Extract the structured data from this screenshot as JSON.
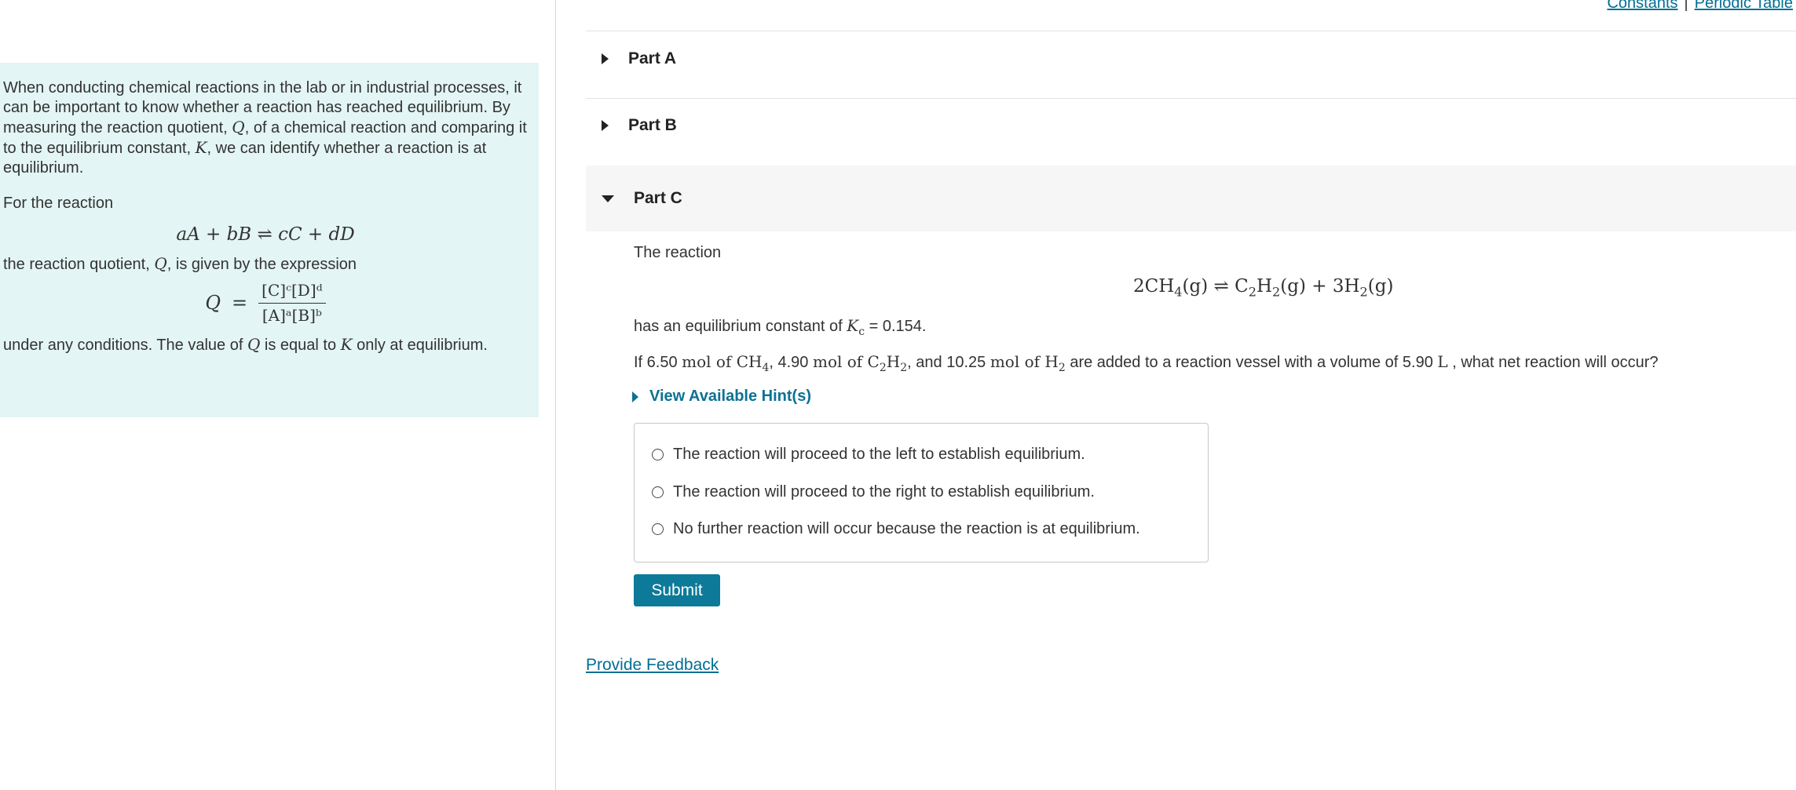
{
  "top_links": {
    "constants": "Constants",
    "separator": "|",
    "periodic_table": "Periodic Table"
  },
  "intro": {
    "para1_a": "When conducting chemical reactions in the lab or in industrial processes, it can be important to know whether a reaction has reached equilibrium. By measuring the reaction quotient, ",
    "Q": "Q",
    "para1_b": ", of a chemical reaction and comparing it to the equilibrium constant, ",
    "K": "K",
    "para1_c": ", we can identify whether a reaction is at equilibrium.",
    "for_reaction": "For the reaction",
    "general_eq": "aA + bB ⇌ cC + dD",
    "quotient_a": "the reaction quotient, ",
    "quotient_b": ", is given by the expression",
    "q_lhs": "Q",
    "equals": "=",
    "numerator": "[C]ᶜ[D]ᵈ",
    "denominator": "[A]ᵃ[B]ᵇ",
    "under_a": "under any conditions. The value of ",
    "under_b": " is equal to ",
    "under_c": " only at equilibrium."
  },
  "parts": [
    {
      "label": "Part A",
      "expanded": false
    },
    {
      "label": "Part B",
      "expanded": false
    },
    {
      "label": "Part C",
      "expanded": true
    }
  ],
  "part_c": {
    "intro": "The reaction",
    "eq_left": "2CH",
    "eq_left_sub": "4",
    "eq_left_state": "(g) ⇌ C",
    "eq_c_sub": "2",
    "eq_h": "H",
    "eq_h_sub": "2",
    "eq_mid": "(g) + 3H",
    "eq_h2_sub": "2",
    "eq_end": "(g)",
    "kc_a": "has an equilibrium constant of ",
    "kc_symbol": "K",
    "kc_sub": "c",
    "kc_b": " = 0.154.",
    "q_if": "If 6.50 ",
    "q_mol1": "mol of CH",
    "q_sub1": "4",
    "q_amt2": ", 4.90 ",
    "q_mol2": "mol of C",
    "q_sub2a": "2",
    "q_h": "H",
    "q_sub2b": "2",
    "q_amt3": ", and 10.25 ",
    "q_mol3": "mol of H",
    "q_sub3": "2",
    "q_rest": " are added to a reaction vessel with a volume of 5.90 ",
    "q_unit": "L",
    "q_end": " , what net reaction will occur?",
    "hint_label": "View Available Hint(s)",
    "options": [
      "The reaction will proceed to the left to establish equilibrium.",
      "The reaction will proceed to the right to establish equilibrium.",
      "No further reaction will occur because the reaction is at equilibrium."
    ],
    "submit": "Submit"
  },
  "feedback": "Provide Feedback",
  "colors": {
    "accent": "#0d7a99",
    "link": "#006f95",
    "intro_bg": "#e3f5f4"
  }
}
